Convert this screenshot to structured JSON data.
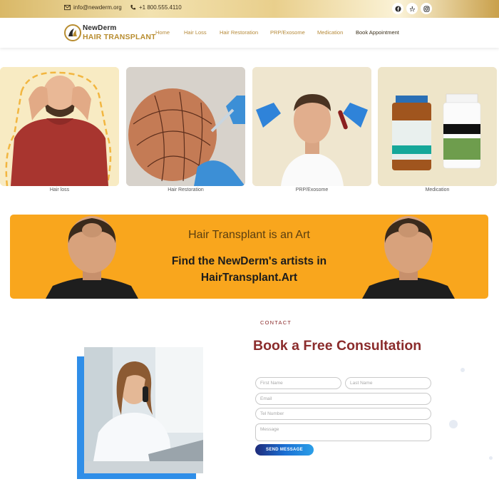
{
  "topbar": {
    "email": "info@newderm.org",
    "phone": "+1 800.555.4110",
    "social": [
      {
        "icon": "facebook-icon"
      },
      {
        "icon": "yelp-icon"
      },
      {
        "icon": "instagram-icon"
      }
    ]
  },
  "header": {
    "logo_top": "NewDerm",
    "logo_bottom": "HAIR TRANSPLANT",
    "nav": [
      "Home",
      "Hair Loss",
      "Hair Restoration",
      "PRP/Exosome",
      "Medication",
      "Book Appointment"
    ]
  },
  "services": [
    {
      "label": "Hair loss"
    },
    {
      "label": "Hair Restoration"
    },
    {
      "label": "PRP/Exosome"
    },
    {
      "label": "Medication"
    }
  ],
  "banner": {
    "title": "Hair Transplant is an Art",
    "line1": "Find the NewDerm's artists in",
    "line2": "HairTransplant.Art"
  },
  "contact": {
    "kicker": "CONTACT",
    "title": "Book a Free Consultation",
    "first_name": "First Name",
    "last_name": "Last Name",
    "email": "Email",
    "tel": "Tel Number",
    "message": "Message",
    "send": "SEND MESSAGE"
  },
  "colors": {
    "gold": "#b88d30",
    "banner": "#f9a61d",
    "heading": "#8b2c2c",
    "button": "#1a6fd3"
  }
}
